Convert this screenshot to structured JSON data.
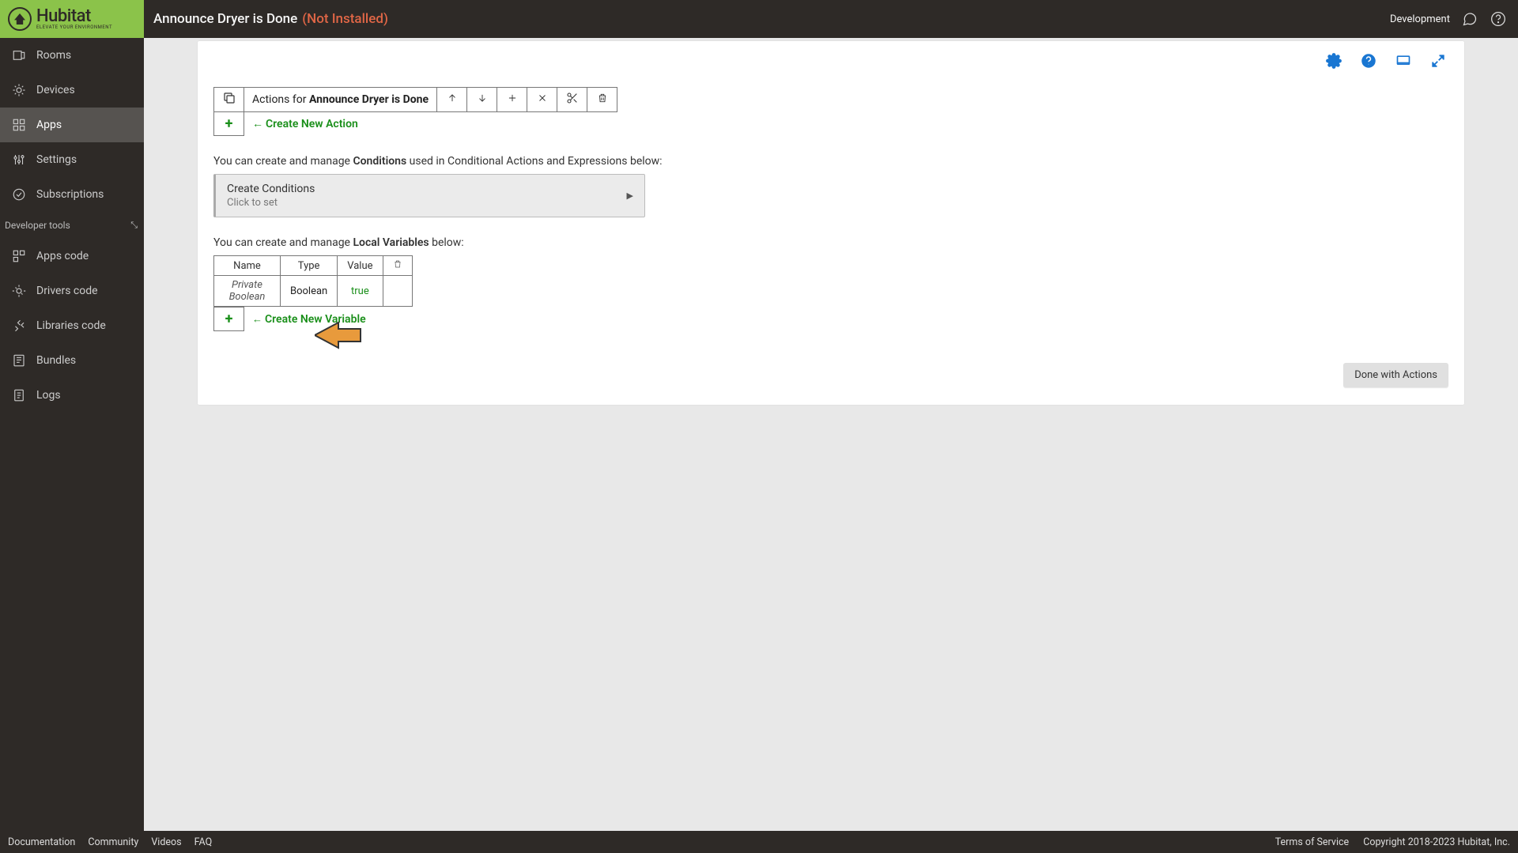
{
  "header": {
    "title": "Announce Dryer is Done",
    "status": "(Not Installed)",
    "right_label": "Development",
    "logo_text": "Hubitat",
    "logo_sub": "ELEVATE YOUR ENVIRONMENT"
  },
  "sidebar": {
    "items": [
      {
        "label": "Rooms"
      },
      {
        "label": "Devices"
      },
      {
        "label": "Apps"
      },
      {
        "label": "Settings"
      },
      {
        "label": "Subscriptions"
      }
    ],
    "section_label": "Developer tools",
    "dev_items": [
      {
        "label": "Apps code"
      },
      {
        "label": "Drivers code"
      },
      {
        "label": "Libraries code"
      },
      {
        "label": "Bundles"
      },
      {
        "label": "Logs"
      }
    ]
  },
  "main": {
    "actions_prefix": "Actions for ",
    "actions_for": "Announce Dryer is Done",
    "create_action": "Create New Action",
    "conditions_text_pre": "You can create and manage ",
    "conditions_text_bold": "Conditions",
    "conditions_text_post": " used in Conditional Actions and Expressions below:",
    "create_conditions": "Create Conditions",
    "click_to_set": "Click to set",
    "variables_text_pre": "You can create and manage ",
    "variables_text_bold": "Local Variables",
    "variables_text_post": " below:",
    "var_headers": {
      "name": "Name",
      "type": "Type",
      "value": "Value"
    },
    "var_rows": [
      {
        "name": "Private Boolean",
        "type": "Boolean",
        "value": "true"
      }
    ],
    "create_variable": "Create New Variable",
    "done_button": "Done with Actions"
  },
  "footer": {
    "left": [
      "Documentation",
      "Community",
      "Videos",
      "FAQ"
    ],
    "right": [
      "Terms of Service",
      "Copyright 2018-2023 Hubitat, Inc."
    ]
  }
}
